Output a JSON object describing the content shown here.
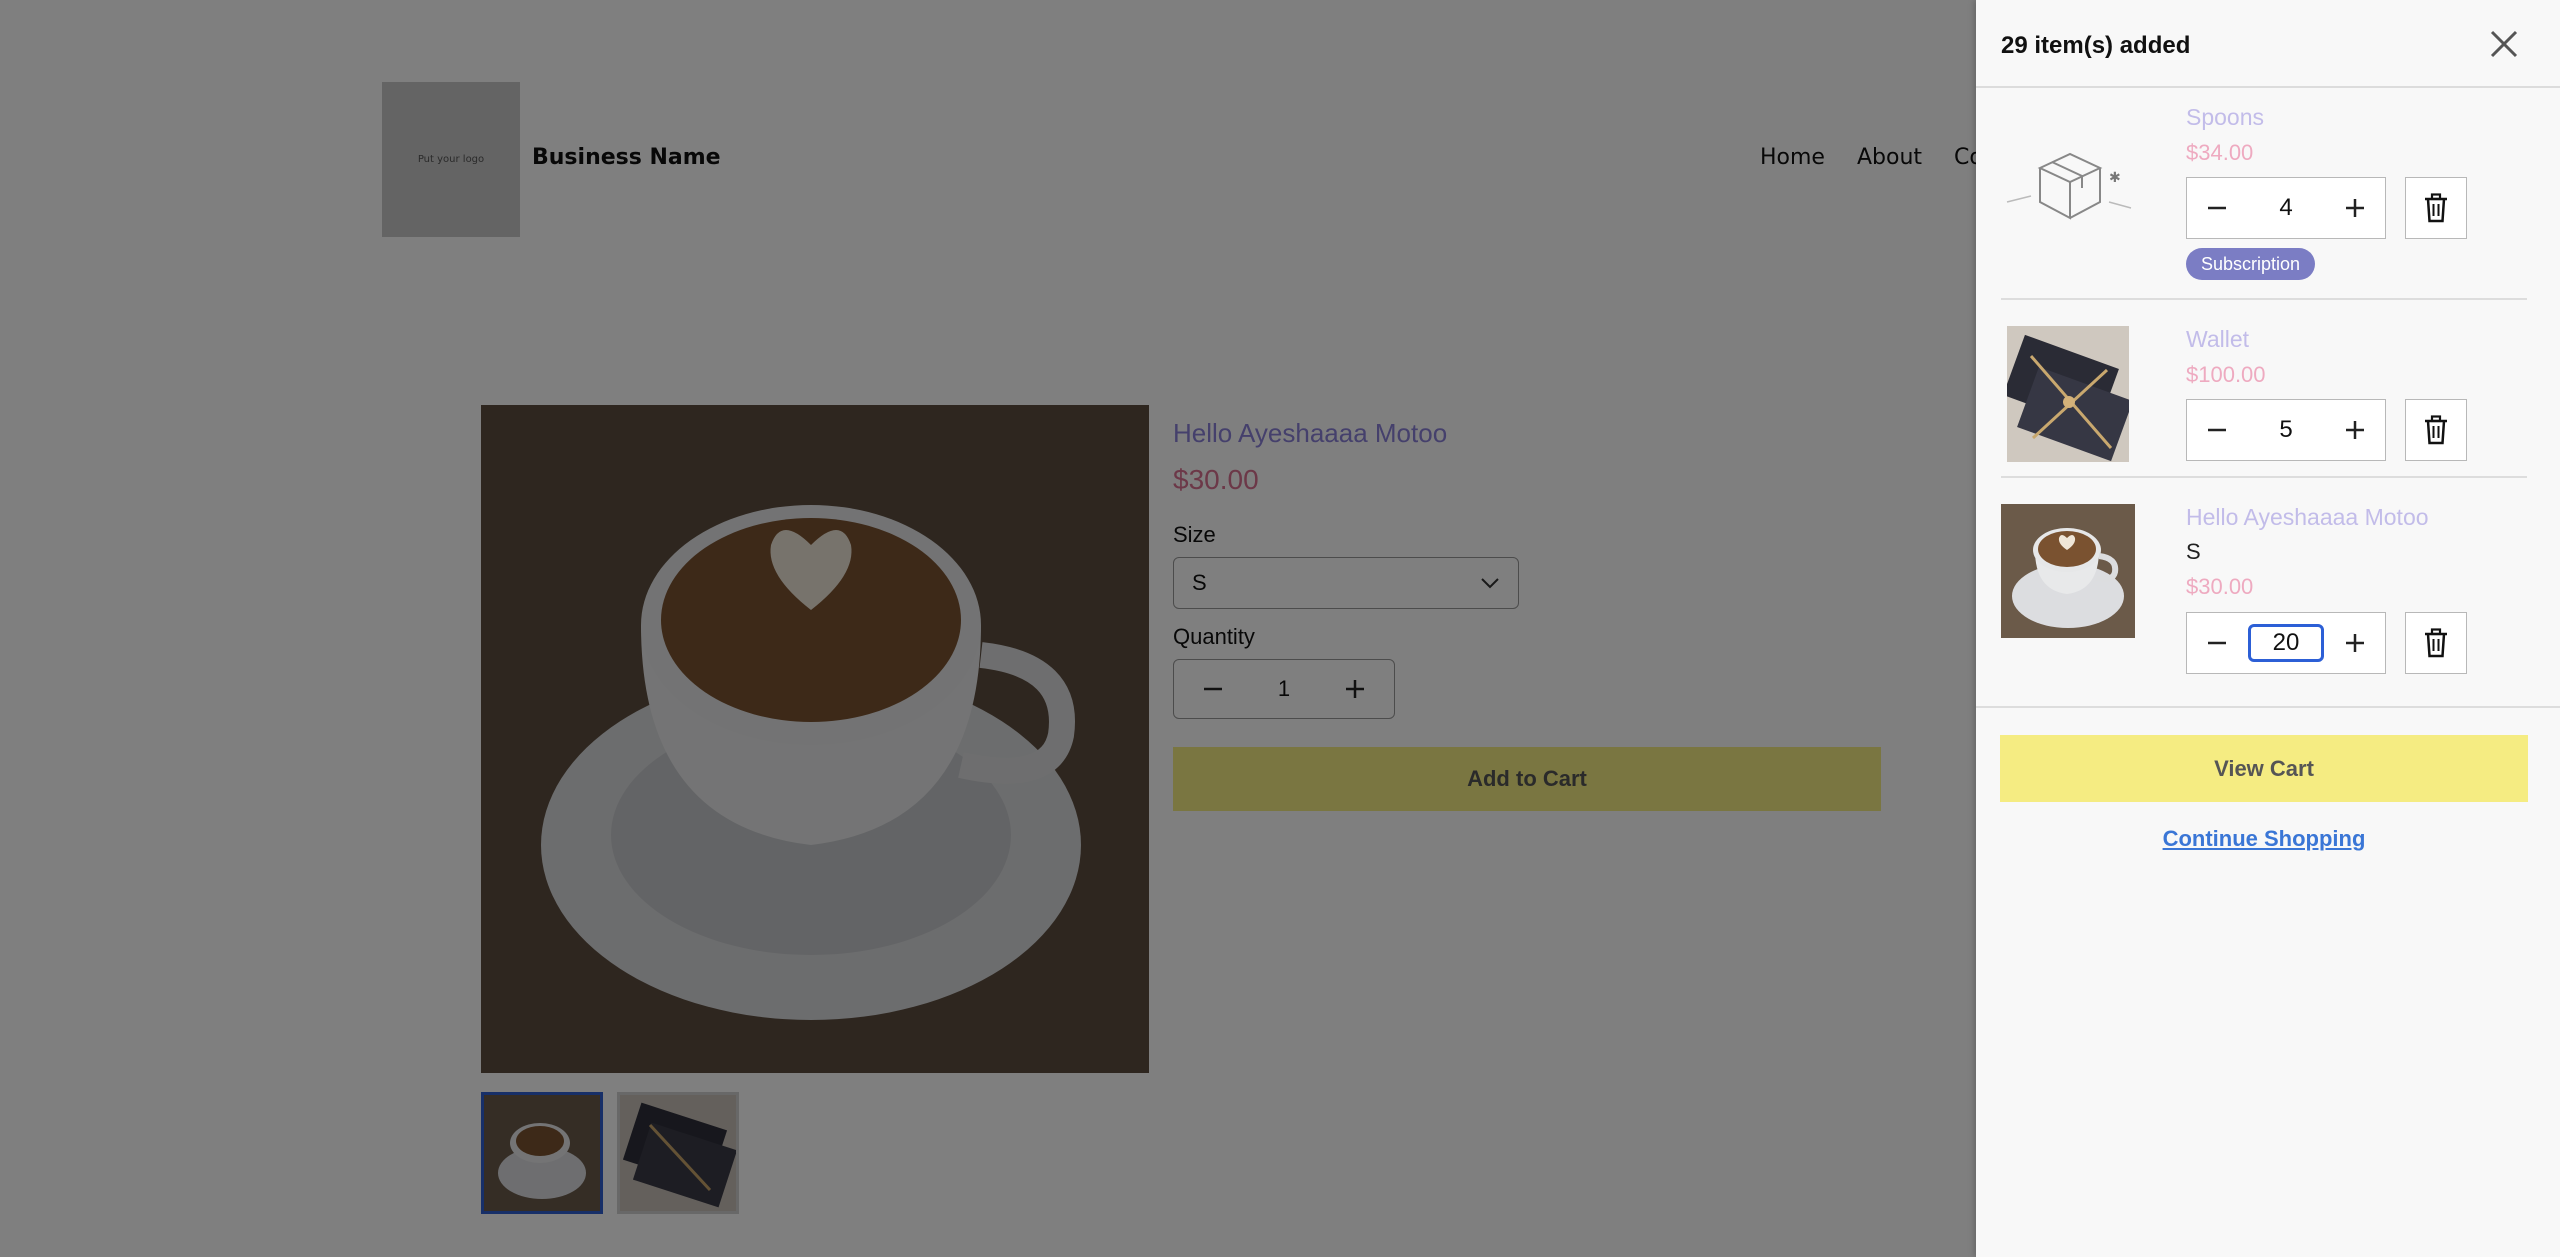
{
  "page": {
    "logo_text": "Put your logo",
    "business_name": "Business Name",
    "nav": [
      "Home",
      "About",
      "Co"
    ],
    "product": {
      "title": "Hello Ayeshaaaa Motoo",
      "price": "$30.00",
      "size_label": "Size",
      "size_value": "S",
      "quantity_label": "Quantity",
      "quantity_value": "1",
      "add_to_cart": "Add to Cart"
    }
  },
  "drawer": {
    "title": "29 item(s) added",
    "items": [
      {
        "name": "Spoons",
        "price": "$34.00",
        "quantity": "4",
        "badge": "Subscription",
        "image": "package-placeholder-icon"
      },
      {
        "name": "Wallet",
        "price": "$100.00",
        "quantity": "5",
        "image": "wrapped-gift-photo"
      },
      {
        "name": "Hello Ayeshaaaa Motoo",
        "variant": "S",
        "price": "$30.00",
        "quantity": "20",
        "image": "coffee-cup-photo"
      }
    ],
    "view_cart": "View Cart",
    "continue_shopping": "Continue Shopping"
  },
  "colors": {
    "accent_yellow": "#f5ec82",
    "badge": "#7b7dc4",
    "link": "#3a76d6",
    "item_name": "#c2bce9",
    "item_price": "#eeaac0"
  }
}
